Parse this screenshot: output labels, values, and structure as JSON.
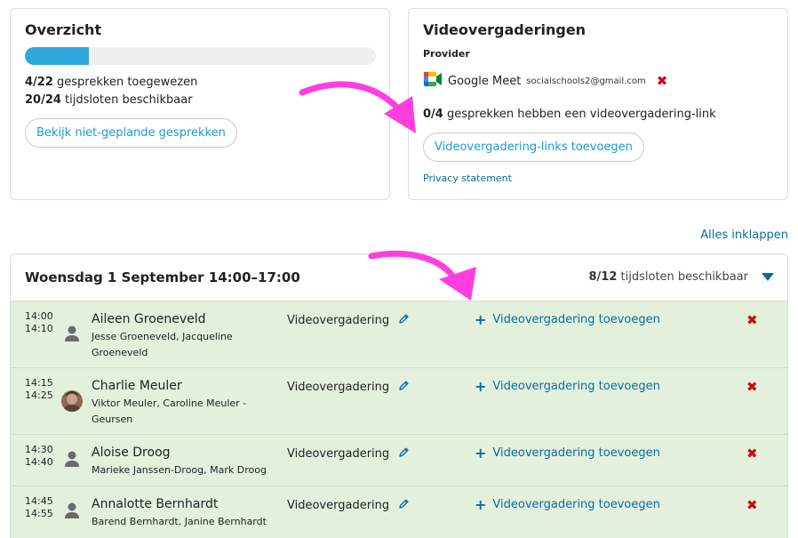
{
  "overview": {
    "title": "Overzicht",
    "progress_fraction": 0.1818,
    "assigned_count": "4/22",
    "assigned_text": "gesprekken toegewezen",
    "available_count": "20/24",
    "available_text": "tijdsloten beschikbaar",
    "unscheduled_button": "Bekijk niet-geplande gesprekken"
  },
  "video": {
    "title": "Videovergaderingen",
    "provider_label": "Provider",
    "provider_name": "Google Meet",
    "provider_email": "socialschools2@gmail.com",
    "remove_symbol": "✖",
    "links_count": "0/4",
    "links_text": "gesprekken hebben een videovergadering-link",
    "add_links_button": "Videovergadering-links toevoegen",
    "privacy_link": "Privacy statement"
  },
  "collapse_all": "Alles inklappen",
  "day": {
    "title": "Woensdag 1 September 14:00–17:00",
    "slots_count": "8/12",
    "slots_text": "tijdsloten beschikbaar"
  },
  "slots": [
    {
      "start": "14:00",
      "end": "14:10",
      "name": "Aileen Groeneveld",
      "parents": "Jesse Groeneveld, Jacqueline Groeneveld",
      "type": "Videovergadering",
      "add_video": "Videovergadering toevoegen",
      "plus": "+",
      "remove": "✖",
      "avatar": "person-icon"
    },
    {
      "start": "14:15",
      "end": "14:25",
      "name": "Charlie Meuler",
      "parents": "Viktor Meuler, Caroline Meuler - Geursen",
      "type": "Videovergadering",
      "add_video": "Videovergadering toevoegen",
      "plus": "+",
      "remove": "✖",
      "avatar": "photo-avatar"
    },
    {
      "start": "14:30",
      "end": "14:40",
      "name": "Aloise Droog",
      "parents": "Marieke Janssen-Droog, Mark Droog",
      "type": "Videovergadering",
      "add_video": "Videovergadering toevoegen",
      "plus": "+",
      "remove": "✖",
      "avatar": "person-icon"
    },
    {
      "start": "14:45",
      "end": "14:55",
      "name": "Annalotte Bernhardt",
      "parents": "Barend Bernhardt, Janine Bernhardt",
      "type": "Videovergadering",
      "add_video": "Videovergadering toevoegen",
      "plus": "+",
      "remove": "✖",
      "avatar": "person-icon"
    }
  ],
  "colors": {
    "accent_blue": "#0b6aa2",
    "button_text_blue": "#1a9bd4",
    "progress_blue": "#30a8dc",
    "row_green": "#e3f0dc",
    "remove_red": "#d0021b",
    "annotation_magenta": "#ff3ee0"
  }
}
